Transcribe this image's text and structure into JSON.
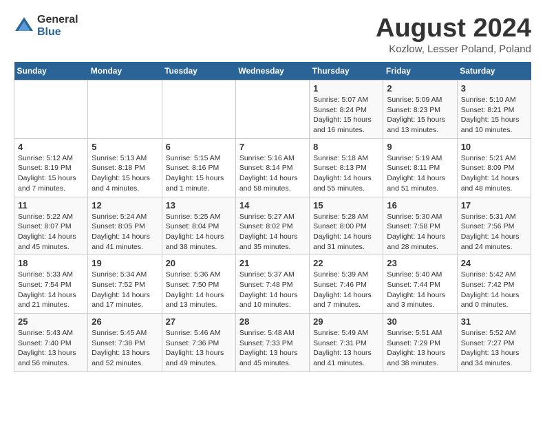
{
  "logo": {
    "general": "General",
    "blue": "Blue"
  },
  "title": "August 2024",
  "subtitle": "Kozlow, Lesser Poland, Poland",
  "days_header": [
    "Sunday",
    "Monday",
    "Tuesday",
    "Wednesday",
    "Thursday",
    "Friday",
    "Saturday"
  ],
  "weeks": [
    [
      {
        "num": "",
        "info": ""
      },
      {
        "num": "",
        "info": ""
      },
      {
        "num": "",
        "info": ""
      },
      {
        "num": "",
        "info": ""
      },
      {
        "num": "1",
        "info": "Sunrise: 5:07 AM\nSunset: 8:24 PM\nDaylight: 15 hours\nand 16 minutes."
      },
      {
        "num": "2",
        "info": "Sunrise: 5:09 AM\nSunset: 8:23 PM\nDaylight: 15 hours\nand 13 minutes."
      },
      {
        "num": "3",
        "info": "Sunrise: 5:10 AM\nSunset: 8:21 PM\nDaylight: 15 hours\nand 10 minutes."
      }
    ],
    [
      {
        "num": "4",
        "info": "Sunrise: 5:12 AM\nSunset: 8:19 PM\nDaylight: 15 hours\nand 7 minutes."
      },
      {
        "num": "5",
        "info": "Sunrise: 5:13 AM\nSunset: 8:18 PM\nDaylight: 15 hours\nand 4 minutes."
      },
      {
        "num": "6",
        "info": "Sunrise: 5:15 AM\nSunset: 8:16 PM\nDaylight: 15 hours\nand 1 minute."
      },
      {
        "num": "7",
        "info": "Sunrise: 5:16 AM\nSunset: 8:14 PM\nDaylight: 14 hours\nand 58 minutes."
      },
      {
        "num": "8",
        "info": "Sunrise: 5:18 AM\nSunset: 8:13 PM\nDaylight: 14 hours\nand 55 minutes."
      },
      {
        "num": "9",
        "info": "Sunrise: 5:19 AM\nSunset: 8:11 PM\nDaylight: 14 hours\nand 51 minutes."
      },
      {
        "num": "10",
        "info": "Sunrise: 5:21 AM\nSunset: 8:09 PM\nDaylight: 14 hours\nand 48 minutes."
      }
    ],
    [
      {
        "num": "11",
        "info": "Sunrise: 5:22 AM\nSunset: 8:07 PM\nDaylight: 14 hours\nand 45 minutes."
      },
      {
        "num": "12",
        "info": "Sunrise: 5:24 AM\nSunset: 8:05 PM\nDaylight: 14 hours\nand 41 minutes."
      },
      {
        "num": "13",
        "info": "Sunrise: 5:25 AM\nSunset: 8:04 PM\nDaylight: 14 hours\nand 38 minutes."
      },
      {
        "num": "14",
        "info": "Sunrise: 5:27 AM\nSunset: 8:02 PM\nDaylight: 14 hours\nand 35 minutes."
      },
      {
        "num": "15",
        "info": "Sunrise: 5:28 AM\nSunset: 8:00 PM\nDaylight: 14 hours\nand 31 minutes."
      },
      {
        "num": "16",
        "info": "Sunrise: 5:30 AM\nSunset: 7:58 PM\nDaylight: 14 hours\nand 28 minutes."
      },
      {
        "num": "17",
        "info": "Sunrise: 5:31 AM\nSunset: 7:56 PM\nDaylight: 14 hours\nand 24 minutes."
      }
    ],
    [
      {
        "num": "18",
        "info": "Sunrise: 5:33 AM\nSunset: 7:54 PM\nDaylight: 14 hours\nand 21 minutes."
      },
      {
        "num": "19",
        "info": "Sunrise: 5:34 AM\nSunset: 7:52 PM\nDaylight: 14 hours\nand 17 minutes."
      },
      {
        "num": "20",
        "info": "Sunrise: 5:36 AM\nSunset: 7:50 PM\nDaylight: 14 hours\nand 13 minutes."
      },
      {
        "num": "21",
        "info": "Sunrise: 5:37 AM\nSunset: 7:48 PM\nDaylight: 14 hours\nand 10 minutes."
      },
      {
        "num": "22",
        "info": "Sunrise: 5:39 AM\nSunset: 7:46 PM\nDaylight: 14 hours\nand 7 minutes."
      },
      {
        "num": "23",
        "info": "Sunrise: 5:40 AM\nSunset: 7:44 PM\nDaylight: 14 hours\nand 3 minutes."
      },
      {
        "num": "24",
        "info": "Sunrise: 5:42 AM\nSunset: 7:42 PM\nDaylight: 14 hours\nand 0 minutes."
      }
    ],
    [
      {
        "num": "25",
        "info": "Sunrise: 5:43 AM\nSunset: 7:40 PM\nDaylight: 13 hours\nand 56 minutes."
      },
      {
        "num": "26",
        "info": "Sunrise: 5:45 AM\nSunset: 7:38 PM\nDaylight: 13 hours\nand 52 minutes."
      },
      {
        "num": "27",
        "info": "Sunrise: 5:46 AM\nSunset: 7:36 PM\nDaylight: 13 hours\nand 49 minutes."
      },
      {
        "num": "28",
        "info": "Sunrise: 5:48 AM\nSunset: 7:33 PM\nDaylight: 13 hours\nand 45 minutes."
      },
      {
        "num": "29",
        "info": "Sunrise: 5:49 AM\nSunset: 7:31 PM\nDaylight: 13 hours\nand 41 minutes."
      },
      {
        "num": "30",
        "info": "Sunrise: 5:51 AM\nSunset: 7:29 PM\nDaylight: 13 hours\nand 38 minutes."
      },
      {
        "num": "31",
        "info": "Sunrise: 5:52 AM\nSunset: 7:27 PM\nDaylight: 13 hours\nand 34 minutes."
      }
    ]
  ]
}
